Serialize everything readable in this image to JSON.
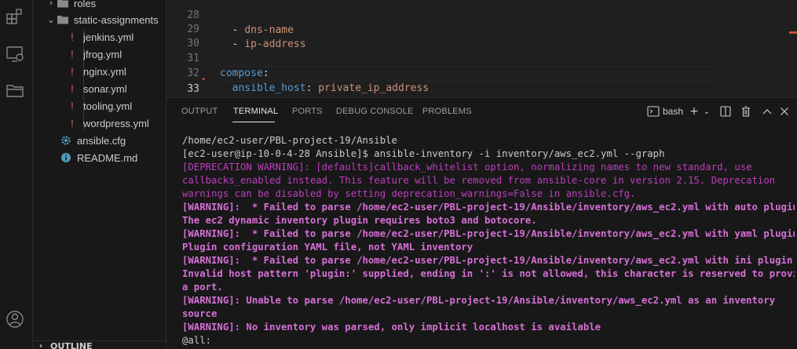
{
  "activity_bar": {
    "icons": [
      "extensions-icon",
      "remote-explorer-icon",
      "folder-icon",
      "account-icon"
    ]
  },
  "sidebar": {
    "items": [
      {
        "label": "roles",
        "kind": "folder-collapsed"
      },
      {
        "label": "static-assignments",
        "kind": "folder-expanded"
      },
      {
        "label": "jenkins.yml",
        "kind": "yml"
      },
      {
        "label": "jfrog.yml",
        "kind": "yml"
      },
      {
        "label": "nginx.yml",
        "kind": "yml"
      },
      {
        "label": "sonar.yml",
        "kind": "yml"
      },
      {
        "label": "tooling.yml",
        "kind": "yml"
      },
      {
        "label": "wordpress.yml",
        "kind": "yml"
      },
      {
        "label": "ansible.cfg",
        "kind": "cfg"
      },
      {
        "label": "README.md",
        "kind": "md"
      }
    ],
    "outline_label": "OUTLINE"
  },
  "editor": {
    "lines": [
      {
        "num": "28",
        "indent": "  ",
        "dash": "- ",
        "text": "dns-name"
      },
      {
        "num": "29",
        "indent": "  ",
        "dash": "- ",
        "text": "ip-address"
      },
      {
        "num": "30",
        "text": ""
      },
      {
        "num": "31",
        "key": "compose",
        "colon": ":"
      },
      {
        "num": "32",
        "indent": "  ",
        "key": "ansible_host",
        "colon": ": ",
        "value": "private_ip_address"
      },
      {
        "num": "33",
        "text": ""
      }
    ]
  },
  "panel": {
    "tabs": [
      "OUTPUT",
      "TERMINAL",
      "PORTS",
      "DEBUG CONSOLE",
      "PROBLEMS"
    ],
    "active_tab": "TERMINAL",
    "shell_label": "bash"
  },
  "terminal": {
    "lines": [
      {
        "style": "norm",
        "text": "/home/ec2-user/PBL-project-19/Ansible"
      },
      {
        "style": "norm",
        "text": "[ec2-user@ip-10-0-4-28 Ansible]$ ansible-inventory -i inventory/aws_ec2.yml --graph"
      },
      {
        "style": "dep",
        "text": "[DEPRECATION WARNING]: [defaults]callback_whitelist option, normalizing names to new standard, use"
      },
      {
        "style": "dep",
        "text": "callbacks_enabled instead. This feature will be removed from ansible-core in version 2.15. Deprecation"
      },
      {
        "style": "dep",
        "text": "warnings can be disabled by setting deprecation_warnings=False in ansible.cfg."
      },
      {
        "style": "warn",
        "text": "[WARNING]:  * Failed to parse /home/ec2-user/PBL-project-19/Ansible/inventory/aws_ec2.yml with auto plugin:"
      },
      {
        "style": "warn",
        "text": "The ec2 dynamic inventory plugin requires boto3 and botocore."
      },
      {
        "style": "warn",
        "text": "[WARNING]:  * Failed to parse /home/ec2-user/PBL-project-19/Ansible/inventory/aws_ec2.yml with yaml plugin:"
      },
      {
        "style": "warn",
        "text": "Plugin configuration YAML file, not YAML inventory"
      },
      {
        "style": "warn",
        "text": "[WARNING]:  * Failed to parse /home/ec2-user/PBL-project-19/Ansible/inventory/aws_ec2.yml with ini plugin:"
      },
      {
        "style": "warn",
        "text": "Invalid host pattern 'plugin:' supplied, ending in ':' is not allowed, this character is reserved to provide"
      },
      {
        "style": "warn",
        "text": "a port."
      },
      {
        "style": "warn",
        "text": "[WARNING]: Unable to parse /home/ec2-user/PBL-project-19/Ansible/inventory/aws_ec2.yml as an inventory"
      },
      {
        "style": "warn",
        "text": "source"
      },
      {
        "style": "warn",
        "text": "[WARNING]: No inventory was parsed, only implicit localhost is available"
      },
      {
        "style": "norm",
        "text": "@all:"
      }
    ]
  }
}
